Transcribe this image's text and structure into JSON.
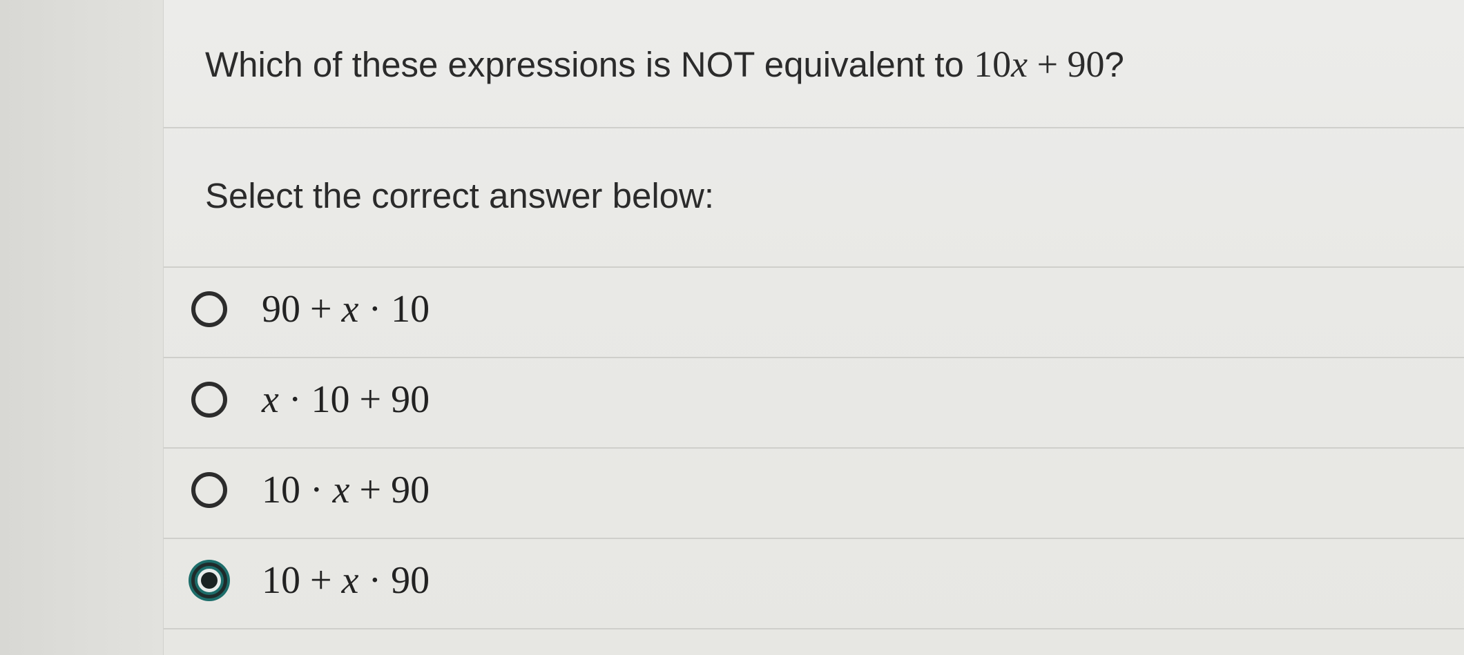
{
  "question": {
    "text_before": "Which of these expressions is NOT equivalent to ",
    "math": "10x + 90",
    "text_after": "?"
  },
  "prompt": "Select the correct answer below:",
  "options": [
    {
      "label": "90 + x · 10",
      "selected": false
    },
    {
      "label": "x · 10 + 90",
      "selected": false
    },
    {
      "label": "10 · x + 90",
      "selected": false
    },
    {
      "label": "10 + x · 90",
      "selected": true
    }
  ],
  "colors": {
    "accent": "#1d6d6a",
    "text": "#2b2b2b",
    "background": "#e9e9e6"
  }
}
